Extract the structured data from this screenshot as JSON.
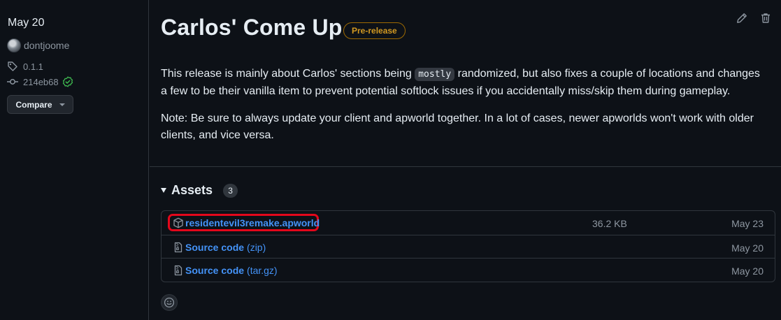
{
  "sidebar": {
    "date": "May 20",
    "author": "dontjoome",
    "tag": "0.1.1",
    "commit": "214eb68",
    "compare_label": "Compare"
  },
  "release": {
    "title": "Carlos' Come Up",
    "badge": "Pre-release",
    "para1_before": "This release is mainly about Carlos' sections being",
    "para1_code": "mostly",
    "para1_after": "randomized, but also fixes a couple of locations and changes a few to be their vanilla item to prevent potential softlock issues if you accidentally miss/skip them during gameplay.",
    "para2": "Note: Be sure to always update your client and apworld together. In a lot of cases, newer apworlds won't work with older clients, and vice versa."
  },
  "assets": {
    "title": "Assets",
    "count": "3",
    "rows": [
      {
        "name": "residentevil3remake.apworld",
        "suffix": "",
        "size": "36.2 KB",
        "date": "May 23"
      },
      {
        "name": "Source code",
        "suffix": "(zip)",
        "size": "",
        "date": "May 20"
      },
      {
        "name": "Source code",
        "suffix": "(tar.gz)",
        "size": "",
        "date": "May 20"
      }
    ]
  },
  "colors": {
    "background": "#0d1117",
    "link": "#4493f8",
    "prerelease": "#d29922",
    "highlight": "#e3071b",
    "verified": "#3fb950"
  },
  "icons": [
    "tag-icon",
    "commit-icon",
    "verified-check-icon",
    "pencil-icon",
    "trash-icon",
    "package-icon",
    "file-zip-icon",
    "smiley-icon"
  ]
}
